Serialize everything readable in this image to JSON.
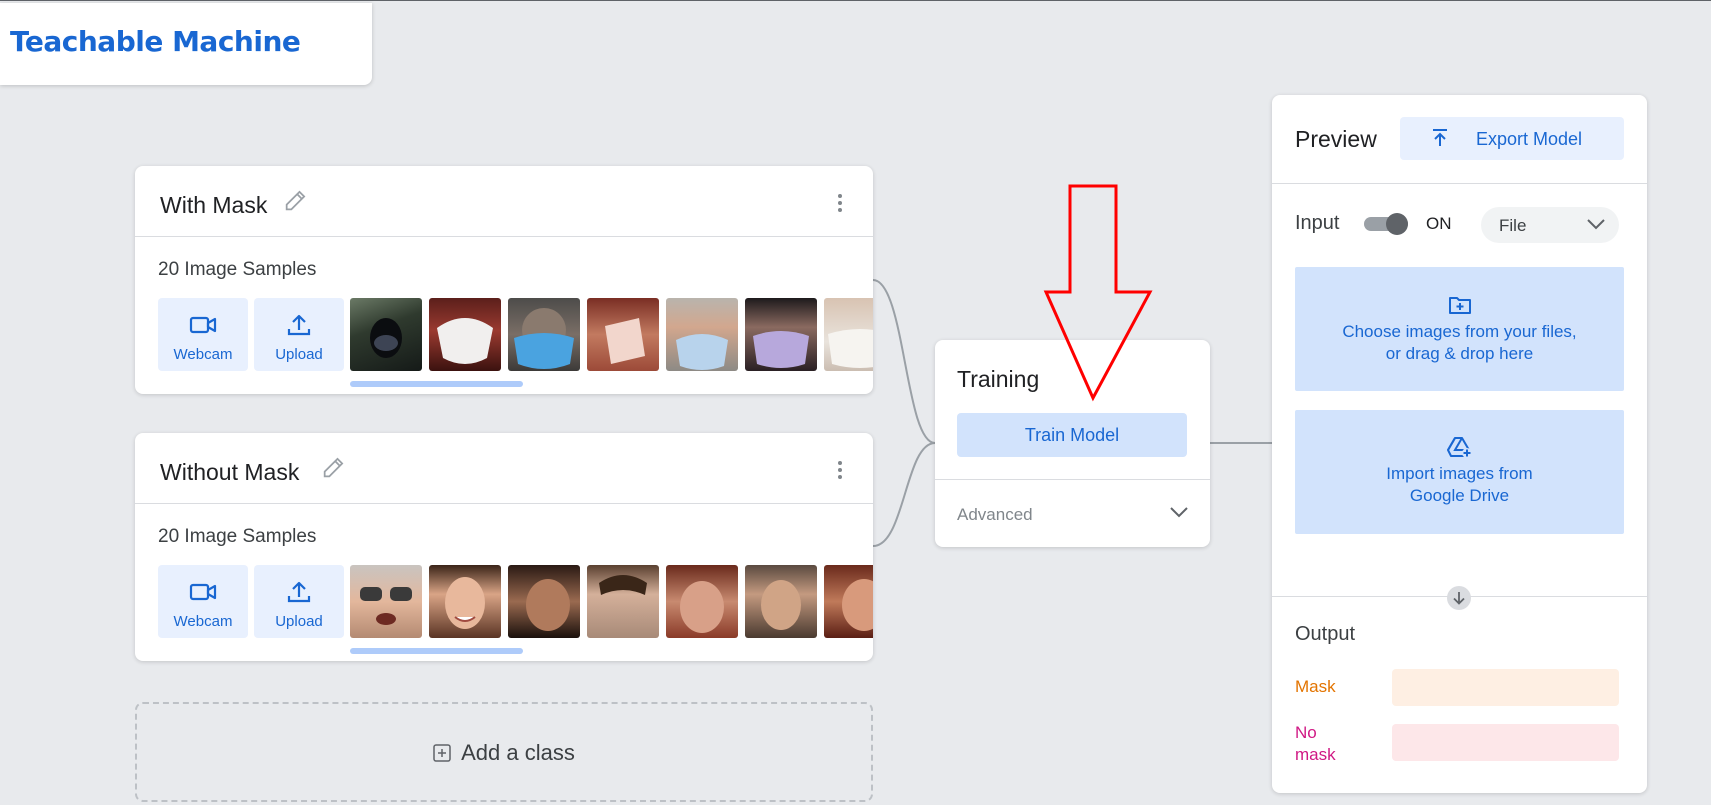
{
  "app": {
    "title": "Teachable Machine"
  },
  "classes": [
    {
      "name": "With Mask",
      "samples_label": "20 Image Samples",
      "webcam_label": "Webcam",
      "upload_label": "Upload"
    },
    {
      "name": "Without Mask",
      "samples_label": "20 Image Samples",
      "webcam_label": "Webcam",
      "upload_label": "Upload"
    }
  ],
  "add_class": {
    "label": "Add a class"
  },
  "training": {
    "title": "Training",
    "train_button": "Train Model",
    "advanced_label": "Advanced"
  },
  "preview": {
    "title": "Preview",
    "export_button": "Export Model",
    "input_label": "Input",
    "toggle_state": "ON",
    "source_select": "File",
    "choose_files_line1": "Choose images from your files,",
    "choose_files_line2": "or drag & drop here",
    "drive_line1": "Import images from",
    "drive_line2": "Google Drive",
    "output_label": "Output",
    "outputs": [
      {
        "name": "Mask",
        "color": "#e37400",
        "bar_color": "#feefe3"
      },
      {
        "name_line1": "No",
        "name_line2": "mask",
        "color": "#d01884",
        "bar_color": "#fde7e9"
      }
    ]
  },
  "colors": {
    "accent": "#1967d2",
    "accent_light": "#e8f0fe",
    "annotation_arrow": "#ff0000"
  }
}
